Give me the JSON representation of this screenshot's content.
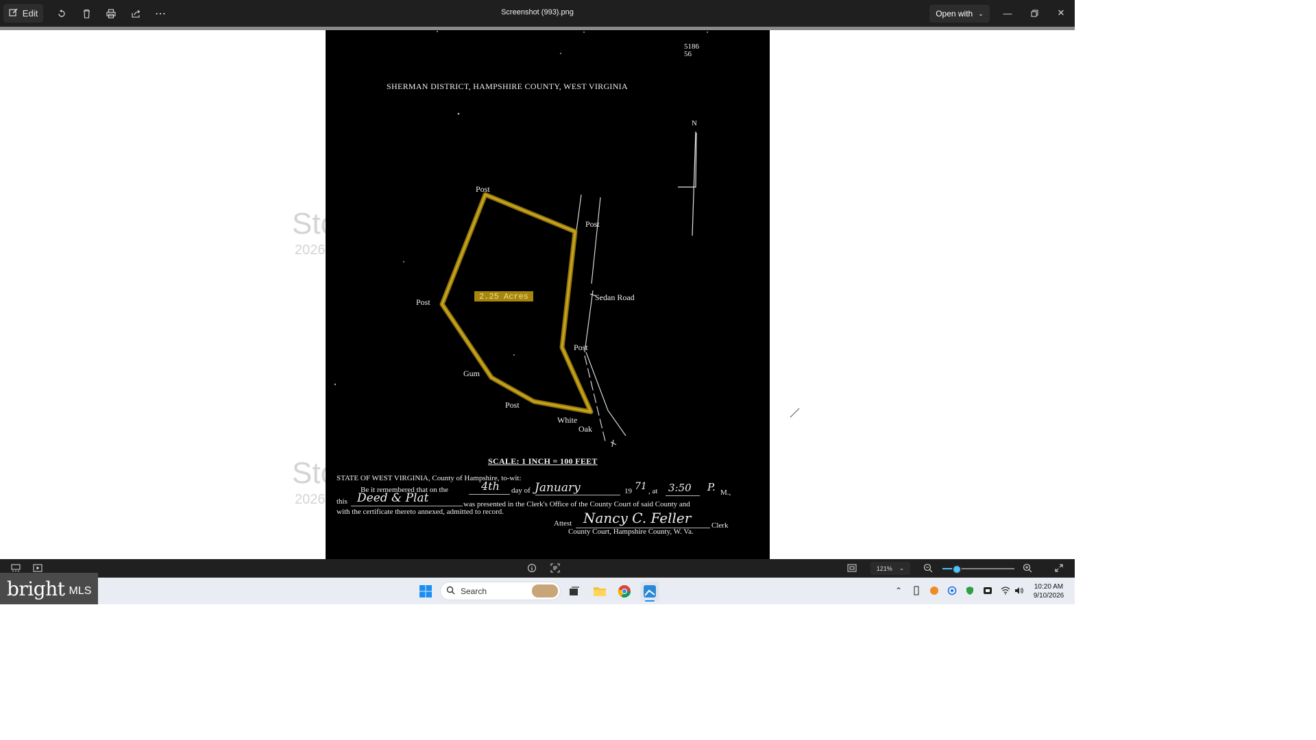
{
  "window": {
    "title": "Screenshot (993).png",
    "edit_label": "Edit",
    "open_with_label": "Open with"
  },
  "background_ghost": {
    "text1": "Sto",
    "year1": "2026",
    "text2": "Sto",
    "year2": "2026"
  },
  "document": {
    "corner_number": "5186\n56",
    "heading": "SHERMAN DISTRICT, HAMPSHIRE COUNTY, WEST VIRGINIA",
    "north": "N",
    "labels": {
      "post_top": "Post",
      "post_right_top": "Post",
      "post_left": "Post",
      "post_right_mid": "Post",
      "post_bottom": "Post",
      "gum": "Gum",
      "white": "White",
      "oak": "Oak",
      "sedan_road": "Sedan Road",
      "acres": "2.25 Acres"
    },
    "scale": "SCALE: 1 INCH = 100 FEET",
    "cert_line1": "STATE OF WEST VIRGINIA, County of Hampshire, to-wit:",
    "cert_line2a": "Be it remembered that on the",
    "cert_day": "4th",
    "cert_line2b": "day of",
    "cert_month": "January",
    "cert_year_prefix": "19",
    "cert_year": "71",
    "cert_at": ", at",
    "cert_time": "3:50",
    "cert_pm": "P.",
    "cert_m": "M.,",
    "cert_this": "this",
    "cert_doc": "Deed & Plat",
    "cert_line3": "was presented in the Clerk's Office of the County Court of said County and",
    "cert_line4": "with the certificate thereto annexed, admitted to record.",
    "attest": "Attest",
    "signature": "Nancy C. Feller",
    "clerk": "Clerk",
    "county_court": "County Court, Hampshire County, W. Va."
  },
  "viewer_toolbar": {
    "zoom": "121%",
    "zoom_level_fraction": 0.2
  },
  "taskbar": {
    "brand": "bright",
    "brand_suffix": "MLS",
    "search_placeholder": "Search",
    "time": "10:20 AM",
    "date": "9/10/2026"
  },
  "colors": {
    "titlebar": "#1f1f1f",
    "parcel_outline": "#b8960f",
    "accent": "#4cc2ff"
  }
}
